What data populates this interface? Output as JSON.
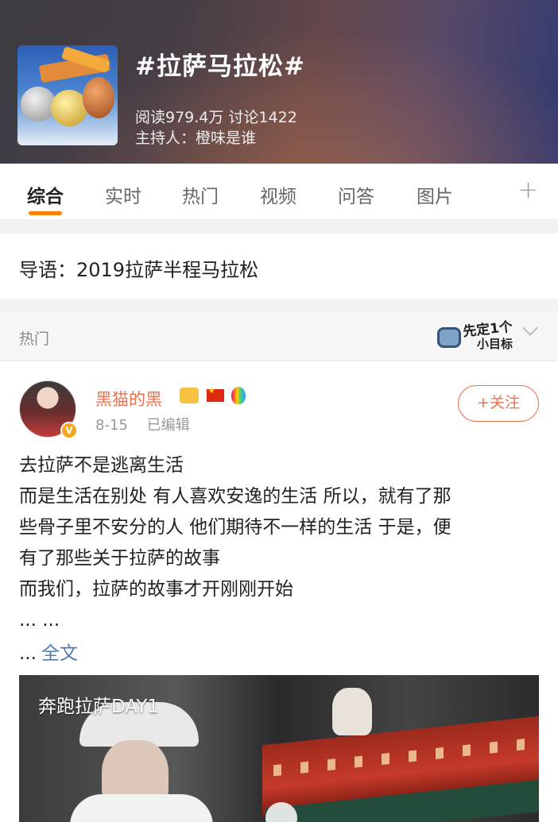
{
  "topic": {
    "title": "#拉萨马拉松#",
    "stats": "阅读979.4万  讨论1422",
    "host": "主持人：橙味是谁"
  },
  "tabs": [
    {
      "label": "综合",
      "active": true
    },
    {
      "label": "实时"
    },
    {
      "label": "热门"
    },
    {
      "label": "视频"
    },
    {
      "label": "问答"
    },
    {
      "label": "图片"
    }
  ],
  "tab_more": "+",
  "intro": "导语：2019拉萨半程马拉松",
  "hot_section": {
    "label": "热门",
    "sticker_line1": "先定1个",
    "sticker_line2": "小目标"
  },
  "post": {
    "username": "黑猫的黑",
    "verified_badge": "V",
    "date": "8-15",
    "edited": "已编辑",
    "follow_label": "+关注",
    "lines": [
      "去拉萨不是逃离生活",
      "而是生活在别处 有人喜欢安逸的生活 所以，就有了那",
      "些骨子里不安分的人 他们期待不一样的生活 于是，便",
      "有了那些关于拉萨的故事",
      "而我们，拉萨的故事才开刚刚开始",
      "... ..."
    ],
    "ellipsis": "...",
    "fulltext_label": "全文",
    "video_title": "奔跑拉萨DAY1"
  },
  "colors": {
    "accent_orange": "#ff8200",
    "username": "#eb7350",
    "link": "#507daf"
  }
}
